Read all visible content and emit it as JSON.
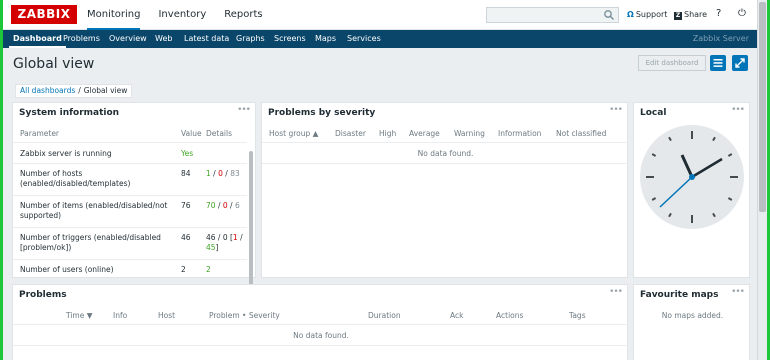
{
  "header": {
    "logo": "ZABBIX",
    "menu": [
      {
        "label": "Monitoring",
        "active": true
      },
      {
        "label": "Inventory",
        "active": false
      },
      {
        "label": "Reports",
        "active": false
      }
    ],
    "search_placeholder": "",
    "support": "Support",
    "share": "Share",
    "help_glyph": "?",
    "signout_glyph": "⏻"
  },
  "subnav": {
    "items": [
      "Dashboard",
      "Problems",
      "Overview",
      "Web",
      "Latest data",
      "Graphs",
      "Screens",
      "Maps",
      "Services"
    ],
    "active": "Dashboard",
    "server": "Zabbix Server"
  },
  "page": {
    "title": "Global view",
    "edit_button": "Edit dashboard",
    "breadcrumb": [
      "All dashboards",
      "Global view"
    ],
    "breadcrumb_sep": "/"
  },
  "system_info": {
    "title": "System information",
    "headers": {
      "parameter": "Parameter",
      "value": "Value",
      "details": "Details"
    },
    "rows": [
      {
        "param": "Zabbix server is running",
        "value": "Yes",
        "details": []
      },
      {
        "param": "Number of hosts\n(enabled/disabled/templates)",
        "value": "84",
        "details": [
          "1",
          "/",
          "0",
          "/",
          "83"
        ]
      },
      {
        "param": "Number of items (enabled/disabled/not\nsupported)",
        "value": "76",
        "details": [
          "70",
          "/",
          "0",
          "/",
          "6"
        ]
      },
      {
        "param": "Number of triggers (enabled/disabled\n[problem/ok])",
        "value": "46",
        "details": [
          "46 / 0 [",
          "1",
          " /\n",
          "45",
          "]"
        ]
      },
      {
        "param": "Number of users (online)",
        "value": "2",
        "details": [
          "2"
        ]
      }
    ]
  },
  "problems_severity": {
    "title": "Problems by severity",
    "columns": [
      "Host group ▲",
      "Disaster",
      "High",
      "Average",
      "Warning",
      "Information",
      "Not classified"
    ],
    "empty": "No data found."
  },
  "local": {
    "title": "Local"
  },
  "problems": {
    "title": "Problems",
    "columns": [
      "Time ▼",
      "Info",
      "Host",
      "Problem • Severity",
      "Duration",
      "Ack",
      "Actions",
      "Tags"
    ],
    "empty": "No data found."
  },
  "favourite_maps": {
    "title": "Favourite maps",
    "empty": "No maps added."
  },
  "widget_menu": "•••",
  "colors": {
    "accent": "#0275b8",
    "nav": "#0a466a",
    "logo": "#d40000",
    "ok": "#40a427",
    "problem": "#d40000"
  }
}
